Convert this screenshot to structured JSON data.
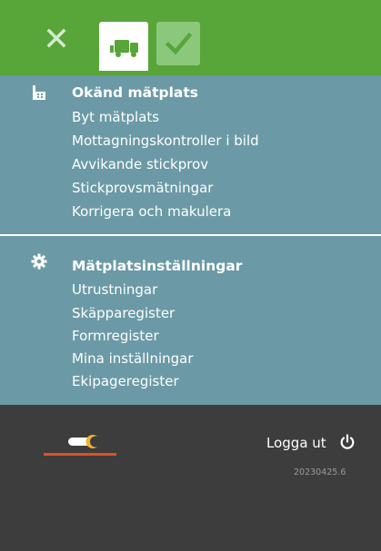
{
  "colors": {
    "topbar": "#58a53a",
    "panel": "#6b9aa6",
    "footer": "#3d3d3d",
    "accent_orange": "#e0521f",
    "check_tab": "#8cc87b"
  },
  "topbar": {
    "icons": [
      "close-icon",
      "truck-icon",
      "check-icon"
    ],
    "active_tab": "truck"
  },
  "section1": {
    "icon": "building-icon",
    "title": "Okänd mätplats",
    "items": [
      "Byt mätplats",
      "Mottagningskontroller i bild",
      "Avvikande stickprov",
      "Stickprovsmätningar",
      "Korrigera och makulera"
    ]
  },
  "section2": {
    "icon": "gear-icon",
    "title": "Mätplatsinställningar",
    "items": [
      "Utrustningar",
      "Skäpparegister",
      "Formregister",
      "Mina inställningar",
      "Ekipageregister"
    ]
  },
  "footer": {
    "logout_label": "Logga ut",
    "power_icon": "power-icon",
    "theme_toggle_icon": "theme-toggle-icon",
    "version": "20230425.6"
  }
}
